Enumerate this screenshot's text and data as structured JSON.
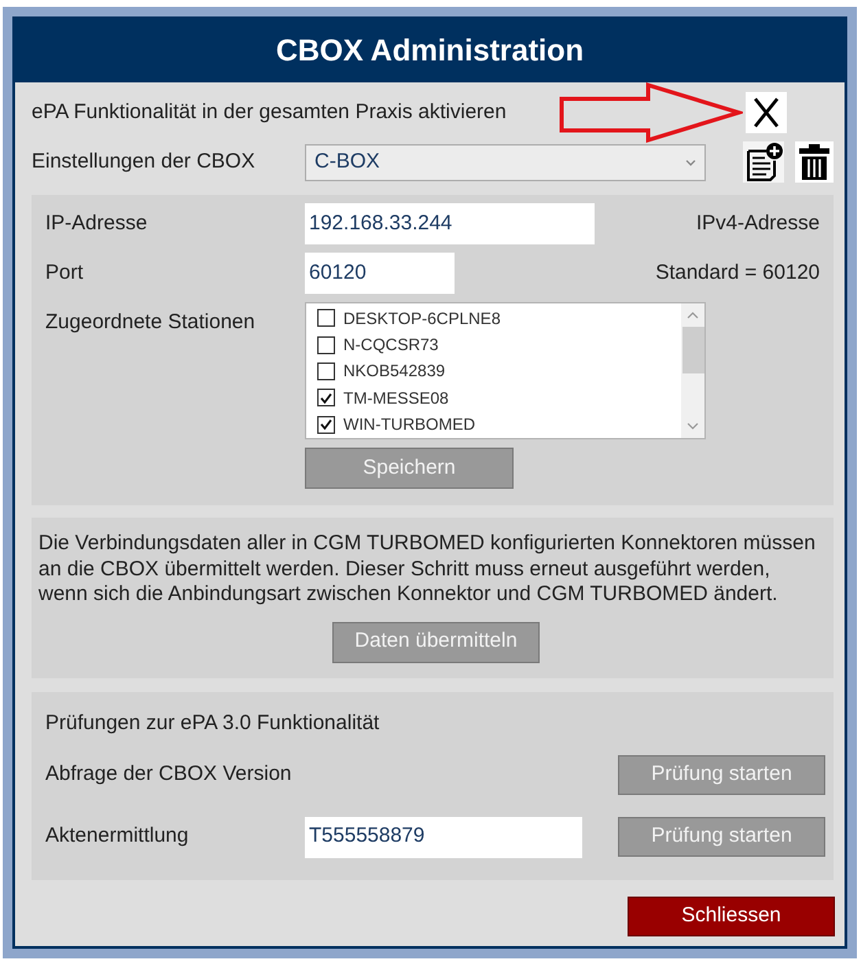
{
  "window": {
    "title": "CBOX Administration"
  },
  "activation": {
    "label": "ePA Funktionalität in der gesamten Praxis aktivieren",
    "checked": true
  },
  "settings": {
    "label": "Einstellungen der CBOX",
    "dropdown": {
      "value": "C-BOX"
    }
  },
  "connection": {
    "fields": [
      {
        "label": "IP-Adresse",
        "value": "192.168.33.244",
        "note": "IPv4-Adresse"
      },
      {
        "label": "Port",
        "value": "60120",
        "note": "Standard = 60120"
      }
    ],
    "stations": {
      "label": "Zugeordnete Stationen",
      "items": [
        {
          "name": "DESKTOP-6CPLNE8",
          "checked": false
        },
        {
          "name": "N-CQCSR73",
          "checked": false
        },
        {
          "name": "NKOB542839",
          "checked": false
        },
        {
          "name": "TM-MESSE08",
          "checked": true
        },
        {
          "name": "WIN-TURBOMED",
          "checked": true
        }
      ]
    },
    "save_button": "Speichern"
  },
  "transfer": {
    "text": "Die Verbindungsdaten aller in CGM TURBOMED konfigurierten Konnektoren müssen an die CBOX übermittelt werden. Dieser Schritt muss erneut ausgeführt werden, wenn sich die Anbindungsart zwischen Konnektor und CGM TURBOMED ändert.",
    "button": "Daten übermitteln"
  },
  "checks": {
    "title": "Prüfungen zur ePA 3.0 Funktionalität",
    "rows": [
      {
        "label": "Abfrage der CBOX Version",
        "button": "Prüfung starten"
      },
      {
        "label": "Aktenermittlung",
        "value": "T555558879",
        "button": "Prüfung starten"
      }
    ]
  },
  "close_button": "Schliessen"
}
